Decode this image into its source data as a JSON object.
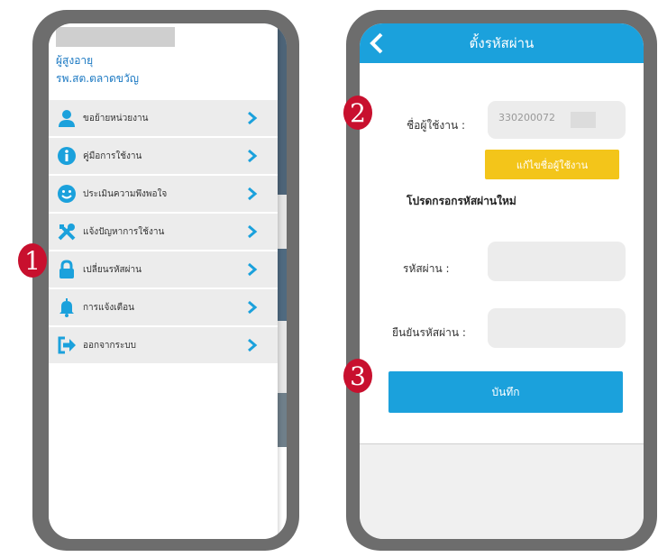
{
  "left_screen": {
    "user_role": "ผู้สูงอายุ",
    "unit_name": "รพ.สต.ตลาดขวัญ",
    "menu_items": [
      {
        "label": "ขอย้ายหน่วยงาน",
        "icon": "user-icon"
      },
      {
        "label": "คู่มือการใช้งาน",
        "icon": "info-icon"
      },
      {
        "label": "ประเมินความพึงพอใจ",
        "icon": "smiley-icon"
      },
      {
        "label": "แจ้งปัญหาการใช้งาน",
        "icon": "tools-icon"
      },
      {
        "label": "เปลี่ยนรหัสผ่าน",
        "icon": "lock-icon"
      },
      {
        "label": "การแจ้งเตือน",
        "icon": "bell-icon"
      },
      {
        "label": "ออกจากระบบ",
        "icon": "logout-icon"
      }
    ]
  },
  "right_screen": {
    "title": "ตั้งรหัสผ่าน",
    "username_label": "ชื่อผู้ใช้งาน :",
    "username_value": "330200072",
    "edit_username_button": "แก้ไขชื่อผู้ใช้งาน",
    "section_title": "โปรดกรอกรหัสผ่านใหม่",
    "password_label": "รหัสผ่าน :",
    "confirm_password_label": "ยืนยันรหัสผ่าน :",
    "save_button": "บันทึก"
  },
  "steps": [
    "1",
    "2",
    "3"
  ],
  "colors": {
    "primary": "#1ba1dc",
    "edit_button": "#f3c51a",
    "step_badge": "#c8102e",
    "menu_icon": "#1ba1dc"
  }
}
